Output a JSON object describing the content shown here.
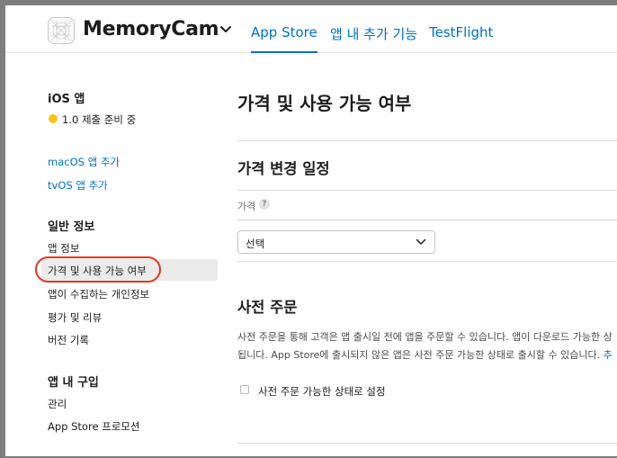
{
  "header": {
    "app_name": "MemoryCam",
    "tabs": [
      {
        "label": "App Store",
        "active": true
      },
      {
        "label": "앱 내 추가 기능",
        "active": false
      },
      {
        "label": "TestFlight",
        "active": false
      }
    ]
  },
  "sidebar": {
    "platform_heading": "iOS 앱",
    "version_status": "1.0 제출 준비 중",
    "status_color": "#f5c518",
    "add_links": [
      "macOS 앱 추가",
      "tvOS 앱 추가"
    ],
    "general_heading": "일반 정보",
    "general_items": [
      "앱 정보",
      "가격 및 사용 가능 여부",
      "앱이 수집하는 개인정보",
      "평가 및 리뷰",
      "버전 기록"
    ],
    "selected_item": "가격 및 사용 가능 여부",
    "iap_heading": "앱 내 구입",
    "iap_items": [
      "관리",
      "App Store 프로모션"
    ]
  },
  "main": {
    "title": "가격 및 사용 가능 여부",
    "price_schedule": {
      "heading": "가격 변경 일정",
      "price_label": "가격",
      "help": "?",
      "select_value": "선택"
    },
    "preorder": {
      "heading": "사전 주문",
      "desc_line1": "사전 주문을 통해 고객은 앱 출시일 전에 앱을 주문할 수 있습니다. 앱이 다운로드 가능한 상",
      "desc_line2": "됩니다. App Store에 출시되지 않은 앱은 사전 주문 가능한 상태로 출시할 수 있습니다.",
      "desc_link": "추",
      "checkbox_label": "사전 주문 가능한 상태로 설정",
      "checkbox_checked": false
    }
  },
  "colors": {
    "accent": "#0070c9",
    "highlight_ring": "#e8341c"
  }
}
